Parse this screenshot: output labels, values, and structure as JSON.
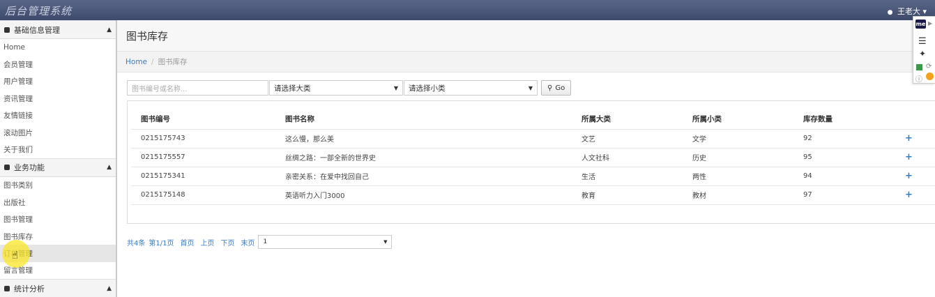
{
  "header": {
    "brand": "后台管理系统",
    "user": "王老大"
  },
  "sidebar": {
    "groups": [
      {
        "title": "基础信息管理",
        "items": [
          "Home",
          "会员管理",
          "用户管理",
          "资讯管理",
          "友情链接",
          "滚动图片",
          "关于我们"
        ]
      },
      {
        "title": "业务功能",
        "items": [
          "图书类别",
          "出版社",
          "图书管理",
          "图书库存",
          "订单管理",
          "留言管理"
        ]
      },
      {
        "title": "统计分析",
        "items": []
      }
    ],
    "active_item": "订单管理"
  },
  "page": {
    "title": "图书库存",
    "breadcrumb": {
      "home": "Home",
      "current": "图书库存"
    }
  },
  "filters": {
    "search_placeholder": "图书编号或名称...",
    "category_select": "请选择大类",
    "subcategory_select": "请选择小类",
    "go_button": "Go"
  },
  "table": {
    "columns": [
      "图书编号",
      "图书名称",
      "所属大类",
      "所属小类",
      "库存数量"
    ],
    "rows": [
      {
        "id": "0215175743",
        "name": "这么慢，那么美",
        "category": "文艺",
        "subcategory": "文学",
        "stock": "92"
      },
      {
        "id": "0215175557",
        "name": "丝绸之路：一部全新的世界史",
        "category": "人文社科",
        "subcategory": "历史",
        "stock": "95"
      },
      {
        "id": "0215175341",
        "name": "亲密关系：在爱中找回自己",
        "category": "生活",
        "subcategory": "两性",
        "stock": "94"
      },
      {
        "id": "0215175148",
        "name": "英语听力入门3000",
        "category": "教育",
        "subcategory": "教材",
        "stock": "97"
      }
    ],
    "action_symbol": "+"
  },
  "pager": {
    "total": "共4条",
    "page_info": "第1/1页",
    "first": "首页",
    "prev": "上页",
    "next": "下页",
    "last": "末页",
    "page_select": "1"
  },
  "widget": {
    "logo": "me"
  },
  "colors": {
    "topbar": "#4a5678",
    "link": "#3b7cc4",
    "plus": "#2f7dc4"
  }
}
